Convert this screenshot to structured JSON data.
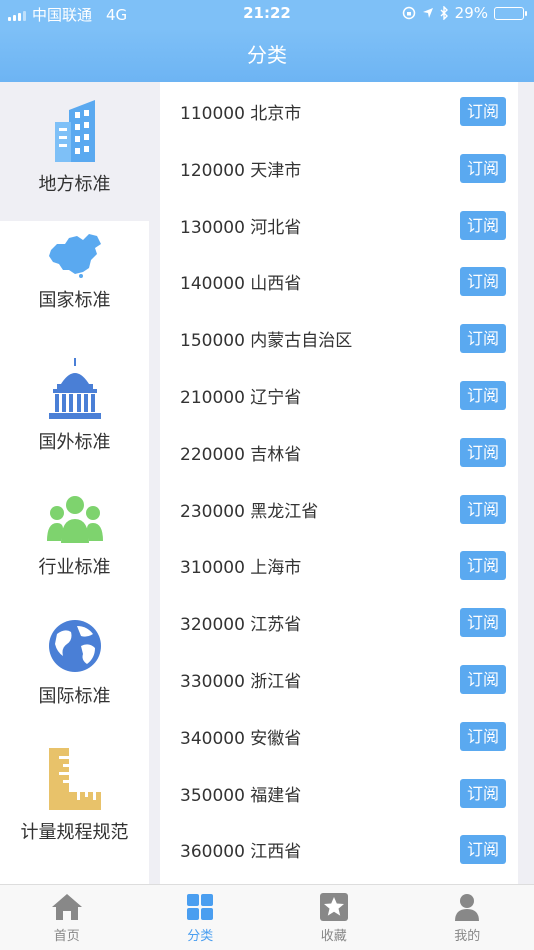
{
  "status_bar": {
    "carrier": "中国联通",
    "network": "4G",
    "time": "21:22",
    "battery": "29%"
  },
  "nav": {
    "title": "分类"
  },
  "sidebar": {
    "items": [
      {
        "label": "地方标准",
        "icon": "building-icon",
        "active": true
      },
      {
        "label": "国家标准",
        "icon": "china-map-icon",
        "active": false
      },
      {
        "label": "国外标准",
        "icon": "capitol-icon",
        "active": false
      },
      {
        "label": "行业标准",
        "icon": "people-icon",
        "active": false
      },
      {
        "label": "国际标准",
        "icon": "globe-icon",
        "active": false
      },
      {
        "label": "计量规程规范",
        "icon": "ruler-icon",
        "active": false
      }
    ]
  },
  "list": {
    "subscribe_label": "订阅",
    "items": [
      "110000 北京市",
      "120000 天津市",
      "130000 河北省",
      "140000 山西省",
      "150000 内蒙古自治区",
      "210000 辽宁省",
      "220000 吉林省",
      "230000 黑龙江省",
      "310000 上海市",
      "320000 江苏省",
      "330000 浙江省",
      "340000 安徽省",
      "350000 福建省",
      "360000 江西省"
    ]
  },
  "tabbar": {
    "tabs": [
      {
        "label": "首页",
        "icon": "home-icon",
        "active": false
      },
      {
        "label": "分类",
        "icon": "grid-icon",
        "active": true
      },
      {
        "label": "收藏",
        "icon": "star-icon",
        "active": false
      },
      {
        "label": "我的",
        "icon": "user-icon",
        "active": false
      }
    ]
  },
  "colors": {
    "nav_blue": "#7ec0f7",
    "button_blue": "#5aa9f0",
    "tab_active": "#4a9ef0"
  }
}
